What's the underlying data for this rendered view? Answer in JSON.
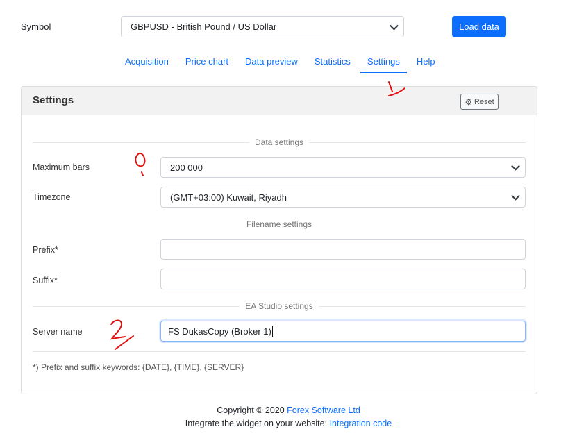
{
  "symbol": {
    "label": "Symbol",
    "selected": "GBPUSD - British Pound / US Dollar",
    "load_button": "Load data"
  },
  "tabs": [
    {
      "label": "Acquisition",
      "active": false
    },
    {
      "label": "Price chart",
      "active": false
    },
    {
      "label": "Data preview",
      "active": false
    },
    {
      "label": "Statistics",
      "active": false
    },
    {
      "label": "Settings",
      "active": true
    },
    {
      "label": "Help",
      "active": false
    }
  ],
  "settings": {
    "title": "Settings",
    "reset_button": "Reset",
    "data_section": "Data settings",
    "max_bars_label": "Maximum bars",
    "max_bars_value": "200 000",
    "timezone_label": "Timezone",
    "timezone_value": "(GMT+03:00) Kuwait, Riyadh",
    "filename_section": "Filename settings",
    "prefix_label": "Prefix*",
    "prefix_value": "",
    "suffix_label": "Suffix*",
    "suffix_value": "",
    "ea_section": "EA Studio settings",
    "server_label": "Server name",
    "server_value": "FS DukasCopy (Broker 1)",
    "note": "*) Prefix and suffix keywords: {DATE}, {TIME}, {SERVER}"
  },
  "footer": {
    "copyright_prefix": "Copyright © 2020",
    "company": "Forex Software Ltd",
    "integrate_prefix": "Integrate the widget on your website:",
    "integration_link": "Integration code"
  },
  "colors": {
    "accent": "#0d6efd",
    "annotation": "#e01010"
  },
  "icons": {
    "reset": "gear-icon",
    "select": "chevron-down-icon"
  }
}
